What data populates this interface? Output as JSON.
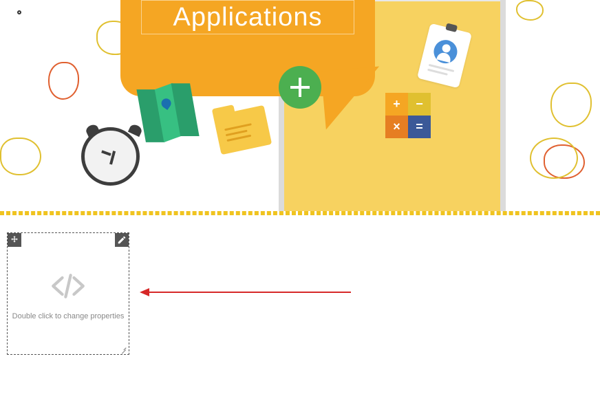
{
  "hero": {
    "title": "Applications",
    "icons": {
      "plus": "add-icon",
      "clock": "alarm-clock-icon",
      "map": "map-icon",
      "folder": "folder-icon",
      "calc": "calculator-icon",
      "badge": "id-badge-icon"
    },
    "calc": {
      "plus": "+",
      "minus": "−",
      "mult": "×",
      "eq": "="
    }
  },
  "widget": {
    "hint": "Double click to change properties"
  }
}
